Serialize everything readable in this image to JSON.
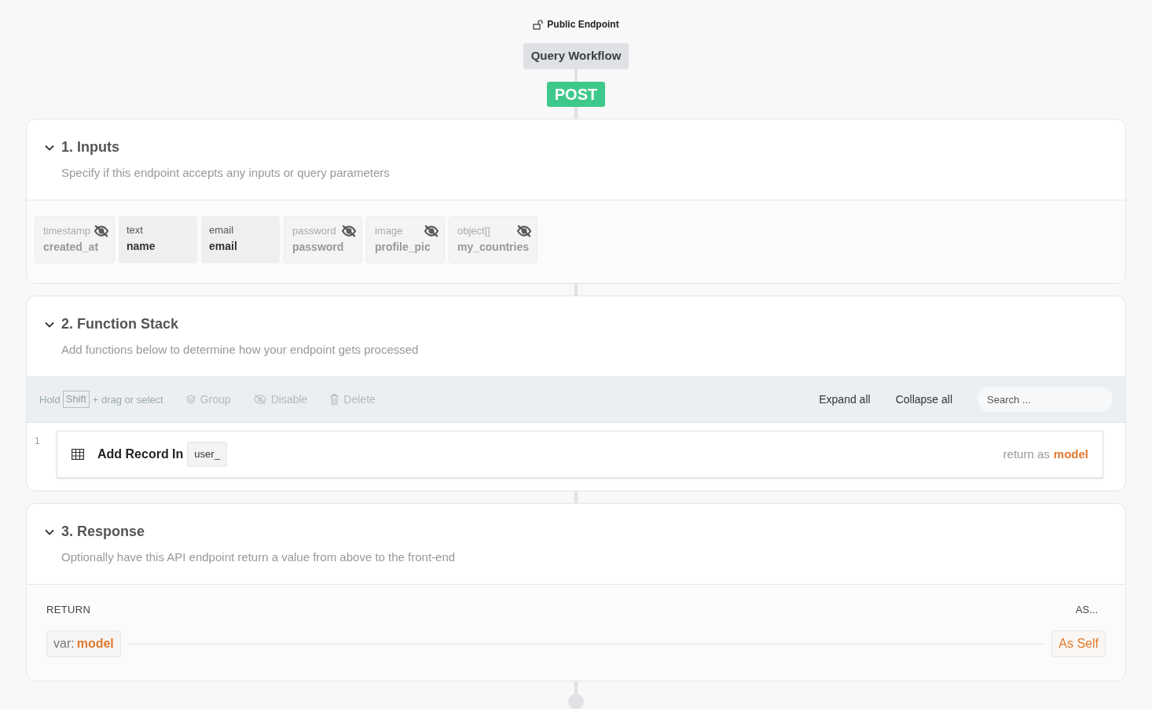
{
  "header": {
    "access": "Public Endpoint",
    "workflow": "Query Workflow",
    "method": "POST"
  },
  "sections": [
    {
      "kind": "inputs",
      "title": "1. Inputs",
      "description": "Specify if this endpoint accepts any inputs or query parameters",
      "expanded": true,
      "inputs": [
        {
          "type": "timestamp",
          "name": "created_at",
          "hidden": true
        },
        {
          "type": "text",
          "name": "name",
          "hidden": false
        },
        {
          "type": "email",
          "name": "email",
          "hidden": false
        },
        {
          "type": "password",
          "name": "password",
          "hidden": true
        },
        {
          "type": "image",
          "name": "profile_pic",
          "hidden": true
        },
        {
          "type": "object[]",
          "name": "my_countries",
          "hidden": true
        }
      ]
    },
    {
      "kind": "stack",
      "title": "2. Function Stack",
      "description": "Add functions below to determine how your endpoint gets processed",
      "expanded": true,
      "toolbar": {
        "hold": "Hold",
        "key": "Shift",
        "hint": "+ drag or select",
        "actions": [
          {
            "kind": "group",
            "label": "Group",
            "disabled": true
          },
          {
            "kind": "disable",
            "label": "Disable",
            "disabled": true
          },
          {
            "kind": "delete",
            "label": "Delete",
            "disabled": true
          }
        ],
        "right_actions": [
          {
            "label": "Expand all"
          },
          {
            "label": "Collapse all"
          }
        ],
        "search": {
          "placeholder": "Search ..."
        }
      },
      "functions": [
        {
          "number": "1",
          "title": "Add Record In",
          "table": "user_",
          "return_label": "return as",
          "return_var": "model"
        }
      ]
    },
    {
      "kind": "response",
      "title": "3. Response",
      "description": "Optionally have this API endpoint return a value from above to the front-end",
      "expanded": true,
      "return_heading": "RETURN",
      "as_heading": "AS...",
      "rows": [
        {
          "prefix": "var:",
          "variable": "model",
          "as": "As Self"
        }
      ]
    }
  ]
}
